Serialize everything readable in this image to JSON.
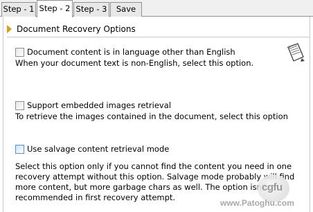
{
  "tabs": [
    {
      "label": "Step - 1"
    },
    {
      "label": "Step - 2"
    },
    {
      "label": "Step - 3"
    },
    {
      "label": "Save"
    }
  ],
  "section": {
    "title": "Document Recovery Options"
  },
  "options": [
    {
      "label": "Document content is in language other than English",
      "description": "When your document text is non-English, select this option.",
      "checked": false
    },
    {
      "label": "Support embedded images retrieval",
      "description": "To retrieve the images contained in the document, select this option",
      "checked": false
    },
    {
      "label": "Use salvage content retrieval mode",
      "description_lines": [
        "Select this option only if you cannot find the content you need in one",
        "recovery attempt without this option. Salvage mode probably will find",
        "more content, but more garbage chars as well. The option isn't",
        "recommended in first recovery attempt."
      ],
      "checked": false
    }
  ],
  "icons": {
    "section_marker": "triangle-right-icon",
    "document": "document-scroll-icon"
  },
  "watermark": {
    "logo": "cgfu",
    "url": "www.Patoghu.com"
  },
  "colors": {
    "section_marker": "#d4a017",
    "tab_border": "#8e8f8f",
    "checkbox_focus": "#5b8fbf"
  }
}
